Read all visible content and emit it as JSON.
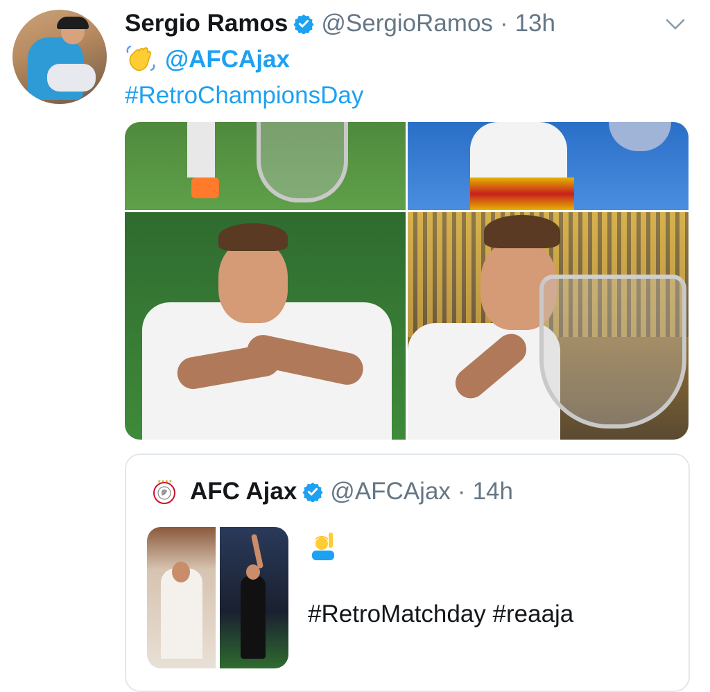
{
  "tweet": {
    "author_name": "Sergio Ramos",
    "author_handle": "@SergioRamos",
    "separator": "·",
    "time": "13h",
    "mention": "@AFCAjax",
    "hashtag": "#RetroChampionsDay",
    "emoji": "waving-hand",
    "verified": true
  },
  "quoted_tweet": {
    "author_name": "AFC Ajax",
    "author_handle": "@AFCAjax",
    "separator": "·",
    "time": "14h",
    "emoji": "person-raising-hand",
    "text": "#RetroMatchday #reaaja",
    "verified": true
  },
  "colors": {
    "link": "#1da1f2",
    "text": "#14171a",
    "muted": "#657786",
    "verified": "#1da1f2",
    "border": "#e1e8ed"
  }
}
